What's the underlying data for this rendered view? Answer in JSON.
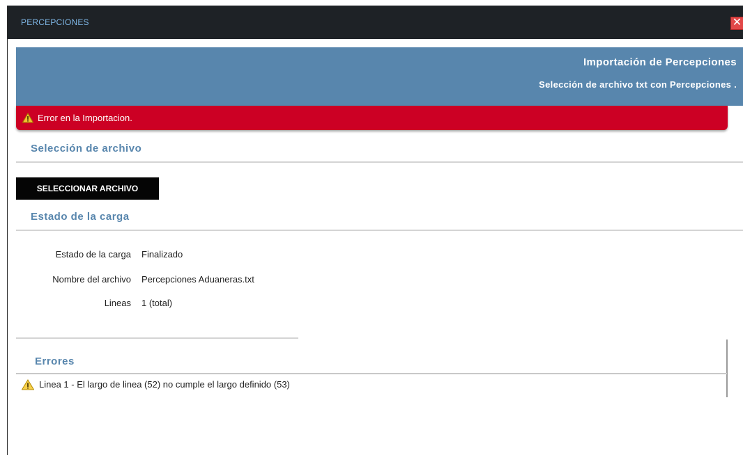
{
  "window": {
    "title": "PERCEPCIONES",
    "close_symbol": "✕"
  },
  "header": {
    "title": "Importación de Percepciones",
    "subtitle": "Selección de archivo txt con Percepciones ."
  },
  "alert": {
    "message": "Error en la Importacion.",
    "color": "#cc0024"
  },
  "file_section": {
    "title": "Selección de archivo",
    "button_label": "SELECCIONAR ARCHIVO"
  },
  "status_section": {
    "title": "Estado de la carga",
    "rows": [
      {
        "label": "Estado de la carga",
        "value": "Finalizado"
      },
      {
        "label": "Nombre del archivo",
        "value": "Percepciones Aduaneras.txt"
      },
      {
        "label": "Lineas",
        "value": "1 (total)"
      }
    ]
  },
  "errors_section": {
    "title": "Errores",
    "items": [
      {
        "text": "Linea 1 - El largo de linea (52) no cumple el largo definido (53)"
      }
    ]
  },
  "colors": {
    "titlebar": "#1e2226",
    "header": "#5886ad",
    "accent": "#5886ad",
    "warning": "#f2c230"
  }
}
